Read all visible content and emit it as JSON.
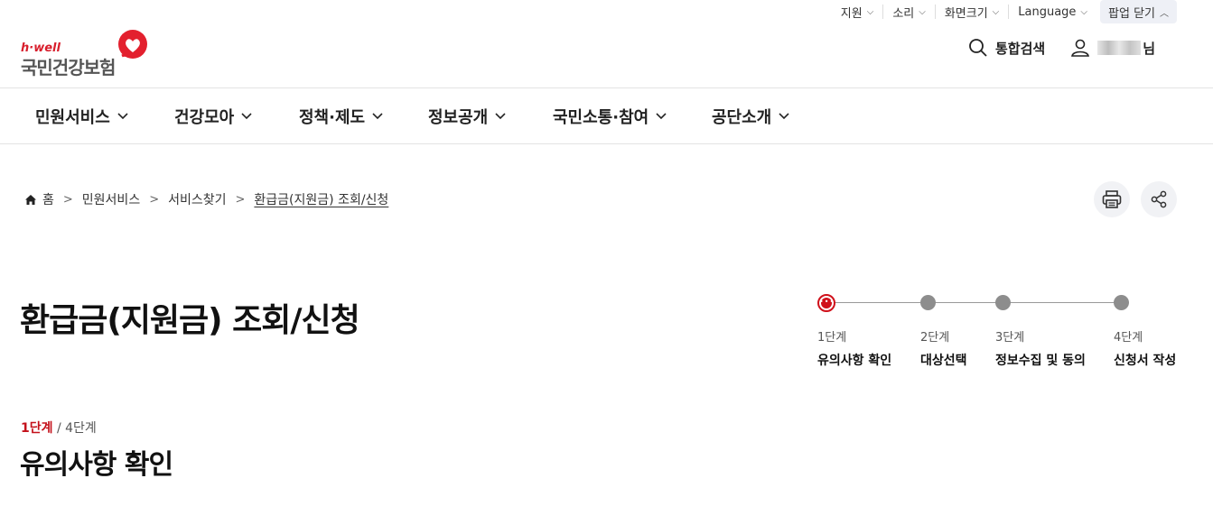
{
  "utility": {
    "items": [
      {
        "label": "지원"
      },
      {
        "label": "소리"
      },
      {
        "label": "화면크기"
      },
      {
        "label": "Language"
      }
    ],
    "popup_close": "팝업 닫기"
  },
  "logo": {
    "brand": "h·well",
    "name": "국민건강보험",
    "heart_color": "#e3202e"
  },
  "header": {
    "search_label": "통합검색",
    "user_suffix": "님"
  },
  "gnb": {
    "items": [
      {
        "label": "민원서비스"
      },
      {
        "label": "건강모아"
      },
      {
        "label": "정책·제도"
      },
      {
        "label": "정보공개"
      },
      {
        "label": "국민소통·참여"
      },
      {
        "label": "공단소개"
      }
    ]
  },
  "breadcrumb": {
    "home": "홈",
    "items": [
      "민원서비스",
      "서비스찾기",
      "환급금(지원금) 조회/신청"
    ]
  },
  "page": {
    "title": "환급금(지원금) 조회/신청"
  },
  "stepper": {
    "steps": [
      {
        "num": "1단계",
        "name": "유의사항 확인",
        "active": true
      },
      {
        "num": "2단계",
        "name": "대상선택",
        "active": false
      },
      {
        "num": "3단계",
        "name": "정보수집 및 동의",
        "active": false
      },
      {
        "num": "4단계",
        "name": "신청서 작성",
        "active": false
      }
    ]
  },
  "section": {
    "current_step": "1단계",
    "divider": " / ",
    "total_steps": "4단계",
    "title": "유의사항 확인"
  },
  "colors": {
    "accent": "#c4111b",
    "inactive_dot": "#8d8d8d"
  }
}
